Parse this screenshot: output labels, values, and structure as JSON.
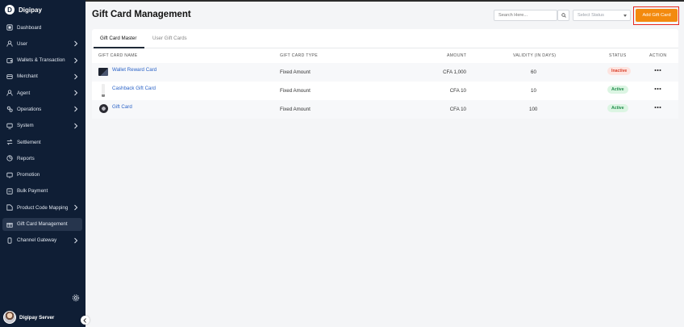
{
  "brand": {
    "name": "Digipay"
  },
  "sidebar": {
    "items": [
      {
        "label": "Dashboard",
        "icon": "dashboard-icon",
        "chevron": false
      },
      {
        "label": "User",
        "icon": "user-icon",
        "chevron": true
      },
      {
        "label": "Wallets & Transaction",
        "icon": "wallet-icon",
        "chevron": true
      },
      {
        "label": "Merchant",
        "icon": "merchant-icon",
        "chevron": true
      },
      {
        "label": "Agent",
        "icon": "agent-icon",
        "chevron": true
      },
      {
        "label": "Operations",
        "icon": "operations-icon",
        "chevron": true
      },
      {
        "label": "System",
        "icon": "system-icon",
        "chevron": true
      },
      {
        "label": "Settlement",
        "icon": "settlement-icon",
        "chevron": false
      },
      {
        "label": "Reports",
        "icon": "reports-icon",
        "chevron": false
      },
      {
        "label": "Promotion",
        "icon": "promotion-icon",
        "chevron": false
      },
      {
        "label": "Bulk Payment",
        "icon": "bulk-payment-icon",
        "chevron": false
      },
      {
        "label": "Product Code Mapping",
        "icon": "product-code-icon",
        "chevron": true
      },
      {
        "label": "Gift Card Management",
        "icon": "gift-icon",
        "chevron": false,
        "active": true
      },
      {
        "label": "Channel Gateway",
        "icon": "channel-icon",
        "chevron": true
      }
    ],
    "user_name": "Digipay Server"
  },
  "header": {
    "title": "Gift Card Management",
    "search_placeholder": "Search Here...",
    "status_placeholder": "Select Status",
    "add_button": "Add Gift Card"
  },
  "tabs": [
    {
      "label": "Gift Card Master",
      "active": true
    },
    {
      "label": "User Gift Cards",
      "active": false
    }
  ],
  "table": {
    "headers": {
      "name": "GIFT CARD NAME",
      "type": "GIFT CARD TYPE",
      "amount": "AMOUNT",
      "validity": "VALIDITY (IN DAYS)",
      "status": "STATUS",
      "action": "ACTION"
    },
    "rows": [
      {
        "name": "Wallet Reward Card",
        "type": "Fixed Amount",
        "amount": "CFA 1,000",
        "validity": "60",
        "status": "Inactive"
      },
      {
        "name": "Cashback Gift Card",
        "type": "Fixed Amount",
        "amount": "CFA 10",
        "validity": "10",
        "status": "Active"
      },
      {
        "name": "Gift Card",
        "type": "Fixed Amount",
        "amount": "CFA 10",
        "validity": "100",
        "status": "Active"
      }
    ]
  },
  "colors": {
    "sidebar_bg": "#0f1e35",
    "accent": "#f38a0e",
    "highlight_border": "#e8281f",
    "link": "#2b63c7"
  }
}
